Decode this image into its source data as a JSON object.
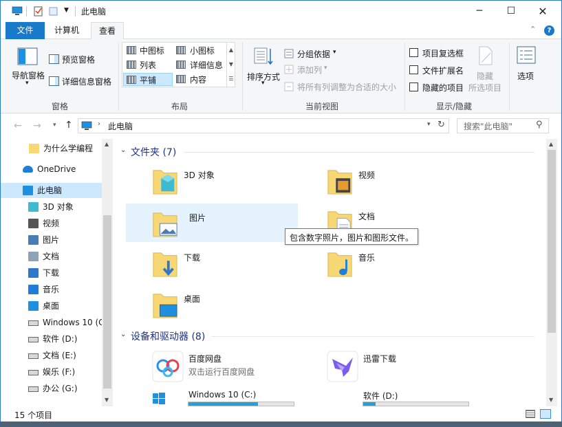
{
  "window": {
    "title": "此电脑"
  },
  "tabs": {
    "file": "文件",
    "computer": "计算机",
    "view": "查看"
  },
  "ribbon": {
    "pane": {
      "nav_pane": "导航窗格",
      "preview": "预览窗格",
      "details": "详细信息窗格",
      "group": "窗格"
    },
    "layout": {
      "medium": "中图标",
      "small": "小图标",
      "list": "列表",
      "details": "详细信息",
      "tiles": "平铺",
      "content": "内容",
      "group": "布局"
    },
    "current": {
      "sort": "排序方式",
      "group_by": "分组依据",
      "add_col": "添加列",
      "fit_cols": "将所有列调整为合适的大小",
      "group": "当前视图"
    },
    "show": {
      "checkboxes": "项目复选框",
      "extensions": "文件扩展名",
      "hidden": "隐藏的项目",
      "hide": "隐藏",
      "selected": "所选项目",
      "options": "选项",
      "group": "显示/隐藏"
    }
  },
  "address": {
    "path": "此电脑",
    "search_placeholder": "搜索\"此电脑\""
  },
  "nav": {
    "items": [
      {
        "label": "为什么学编程",
        "icon": "folder-icon"
      },
      {
        "label": "OneDrive",
        "icon": "cloud-icon"
      },
      {
        "label": "此电脑",
        "icon": "computer-icon"
      },
      {
        "label": "3D 对象",
        "icon": "3d-objects-icon"
      },
      {
        "label": "视频",
        "icon": "video-icon"
      },
      {
        "label": "图片",
        "icon": "pictures-icon"
      },
      {
        "label": "文档",
        "icon": "documents-icon"
      },
      {
        "label": "下载",
        "icon": "download-icon"
      },
      {
        "label": "音乐",
        "icon": "music-icon"
      },
      {
        "label": "桌面",
        "icon": "desktop-icon"
      },
      {
        "label": "Windows 10 (C",
        "icon": "drive-icon"
      },
      {
        "label": "软件 (D:)",
        "icon": "drive-icon"
      },
      {
        "label": "文档 (E:)",
        "icon": "drive-icon"
      },
      {
        "label": "娱乐 (F:)",
        "icon": "drive-icon"
      },
      {
        "label": "办公 (G:)",
        "icon": "drive-icon"
      }
    ]
  },
  "content": {
    "folders_header": "文件夹 (7)",
    "folders": [
      "3D 对象",
      "视频",
      "图片",
      "文档",
      "下载",
      "音乐",
      "桌面"
    ],
    "devices_header": "设备和驱动器 (8)",
    "devices": [
      {
        "name": "百度网盘",
        "sub": "双击运行百度网盘"
      },
      {
        "name": "迅雷下载",
        "sub": ""
      },
      {
        "name": "Windows 10 (C:)",
        "usage": 0.66
      },
      {
        "name": "软件 (D:)",
        "usage": 0.12
      }
    ],
    "tooltip": "包含数字照片，图片和图形文件。"
  },
  "status": {
    "count": "15 个项目"
  },
  "colors": {
    "accent": "#1979ca",
    "hover": "#e5f3ff",
    "selected": "#cce8ff",
    "folder": "#f8d775"
  }
}
